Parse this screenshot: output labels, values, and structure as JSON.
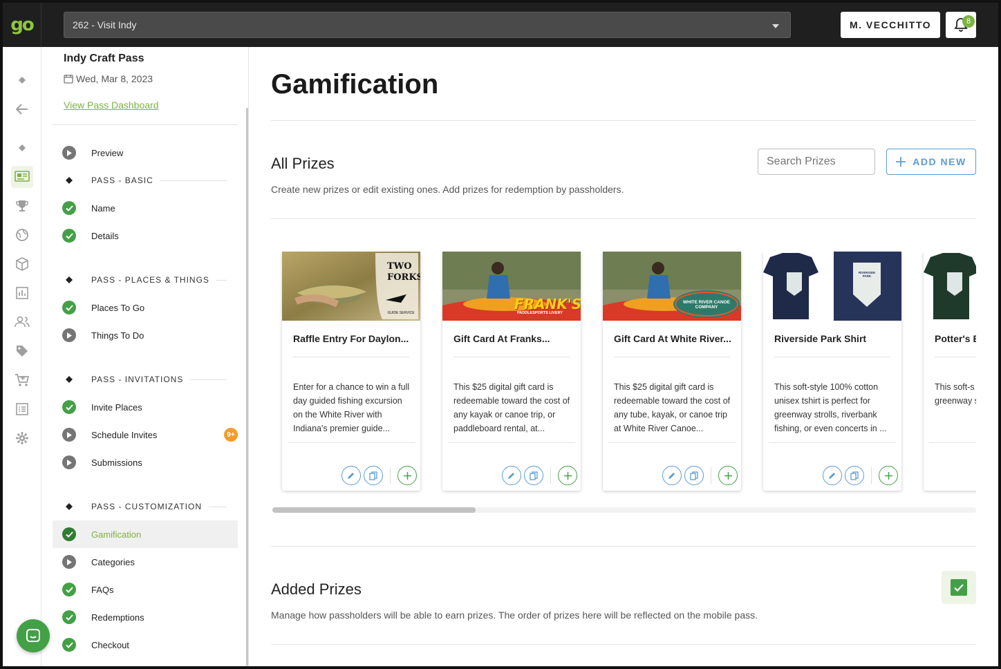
{
  "topbar": {
    "logo_text": "go",
    "org_select_value": "262 - Visit Indy",
    "user_label": "M. VECCHITTO",
    "notification_count": "8"
  },
  "nav": {
    "pass_title": "Indy Craft Pass",
    "pass_date": "Wed, Mar 8, 2023",
    "dashboard_link": "View Pass Dashboard",
    "preview_label": "Preview",
    "sections": {
      "basic": "PASS - BASIC",
      "places": "PASS - PLACES & THINGS",
      "invitations": "PASS - INVITATIONS",
      "customization": "PASS - CUSTOMIZATION"
    },
    "items": {
      "name": "Name",
      "details": "Details",
      "places_to_go": "Places To Go",
      "things_to_do": "Things To Do",
      "invite_places": "Invite Places",
      "schedule_invites": "Schedule Invites",
      "schedule_badge": "9+",
      "submissions": "Submissions",
      "gamification": "Gamification",
      "categories": "Categories",
      "faqs": "FAQs",
      "redemptions": "Redemptions",
      "checkout": "Checkout"
    }
  },
  "main": {
    "page_title": "Gamification",
    "all_prizes": {
      "title": "All Prizes",
      "description": "Create new prizes or edit existing ones. Add prizes for redemption by passholders.",
      "search_placeholder": "Search Prizes",
      "add_new_label": "ADD NEW"
    },
    "added_prizes": {
      "title": "Added Prizes",
      "description": "Manage how passholders will be able to earn prizes. The order of prizes here will be reflected on the mobile pass."
    },
    "prizes": [
      {
        "title": "Raffle Entry For Daylon...",
        "description": "Enter for a chance to win a full day guided fishing excursion on the White River with Indiana's premier guide...",
        "logo_text": "TWO FORKS",
        "logo_sub": "GUIDE SERVICE"
      },
      {
        "title": "Gift Card At Franks...",
        "description": "This $25 digital gift card is redeemable toward the cost of any kayak or canoe trip, or paddleboard rental, at...",
        "logo_text": "FRANK'S",
        "logo_sub": "PADDLESPORTS LIVERY"
      },
      {
        "title": "Gift Card At White River...",
        "description": "This $25 digital gift card is redeemable toward the cost of any tube, kayak, or canoe trip at White River Canoe...",
        "logo_text": "WHITE RIVER CANOE COMPANY",
        "logo_sub": ""
      },
      {
        "title": "Riverside Park Shirt",
        "description": "This soft-style 100% cotton unisex tshirt is perfect for greenway strolls, riverbank fishing, or even concerts in ...",
        "logo_text": "RIVERSIDE PARK",
        "logo_sub": ""
      },
      {
        "title": "Potter's B",
        "description": "This soft-s unisex tshi greenway s fishing, or",
        "logo_text": "",
        "logo_sub": ""
      }
    ]
  },
  "colors": {
    "brand_green": "#8dc63f",
    "accent_blue": "#5b9bd5",
    "check_green": "#43a047",
    "badge_orange": "#f39c2c"
  }
}
